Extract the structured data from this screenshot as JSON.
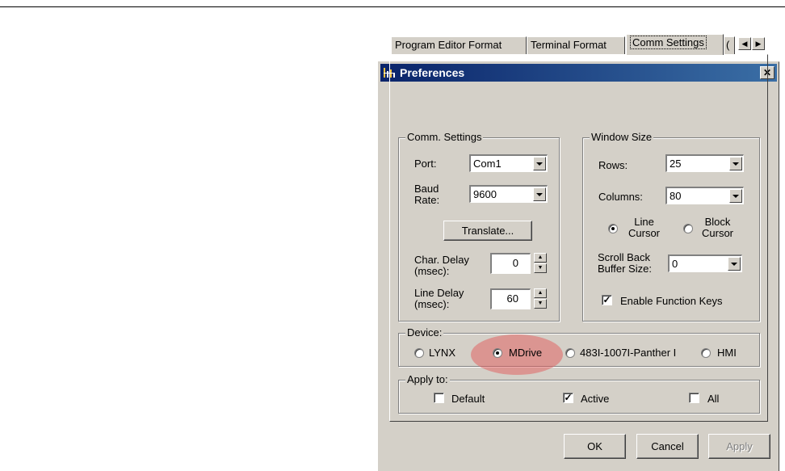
{
  "window": {
    "title": "Preferences",
    "close_glyph": "✕"
  },
  "tabs": [
    {
      "label": "Program Editor Format",
      "active": false
    },
    {
      "label": "Terminal Format",
      "active": false
    },
    {
      "label": "Comm Settings",
      "active": true
    },
    {
      "label": "(",
      "active": false
    }
  ],
  "tab_scroll": {
    "left": "◀",
    "right": "▶"
  },
  "comm_settings": {
    "group_title": "Comm. Settings",
    "port_label": "Port:",
    "port_value": "Com1",
    "baud_label": "Baud\nRate:",
    "baud_value": "9600",
    "translate_button": "Translate...",
    "char_delay_label": "Char. Delay\n(msec):",
    "char_delay_value": "0",
    "line_delay_label": "Line Delay\n(msec):",
    "line_delay_value": "60"
  },
  "window_size": {
    "group_title": "Window Size",
    "rows_label": "Rows:",
    "rows_value": "25",
    "columns_label": "Columns:",
    "columns_value": "80",
    "line_cursor_label": "Line\nCursor",
    "block_cursor_label": "Block\nCursor",
    "cursor_selected": "Line Cursor",
    "scroll_back_label": "Scroll Back\nBuffer Size:",
    "scroll_back_value": "0",
    "enable_function_keys_label": "Enable Function Keys",
    "enable_function_keys_checked": true
  },
  "device": {
    "group_title": "Device:",
    "options": [
      "LYNX",
      "MDrive",
      "483I-1007I-Panther I",
      "HMI"
    ],
    "selected": "MDrive"
  },
  "apply_to": {
    "group_title": "Apply to:",
    "default_label": "Default",
    "default_checked": false,
    "active_label": "Active",
    "active_checked": true,
    "all_label": "All",
    "all_checked": false
  },
  "buttons": {
    "ok": "OK",
    "cancel": "Cancel",
    "apply": "Apply"
  },
  "colors": {
    "title_bar_start": "#0a246a",
    "title_bar_end": "#3a6ea5",
    "dialog_face": "#d4d0c8",
    "highlight": "#e25a5a"
  }
}
